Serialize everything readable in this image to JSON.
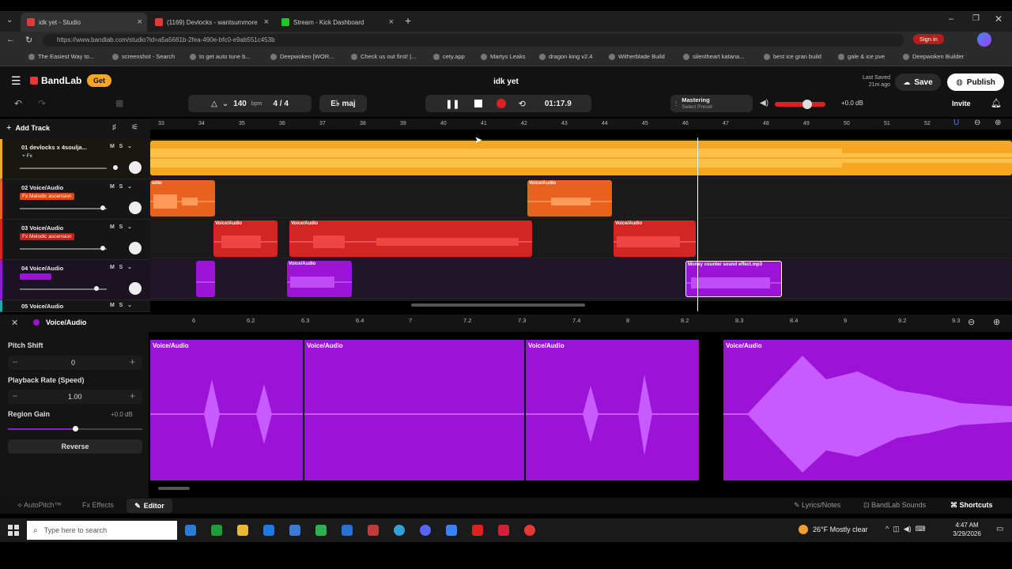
{
  "browser": {
    "tabs": [
      {
        "title": "idk yet - Studio",
        "color": "#e53935"
      },
      {
        "title": "(1169) Devlocks - wantsummore",
        "color": "#e53935"
      },
      {
        "title": "Stream - Kick Dashboard",
        "color": "#27c227"
      }
    ],
    "url": "https://www.bandlab.com/studio?id=a5a5661b-2fea-490e-bfc0-e9ab551c453b",
    "bookmarks": [
      "The Easiest Way to...",
      "screenshot - Search",
      "to get auto tune b...",
      "Deepwoken [WOR...",
      "Check us out first! |...",
      "cety.app",
      "Martys Leaks",
      "dragon king v2.4",
      "Witherblade Build",
      "silentheart katana...",
      "best ice gran build",
      "gale & ice pve",
      "Deepwoken Builder"
    ],
    "signin_label": "Sign in"
  },
  "app": {
    "brand": "BandLab",
    "get_label": "Get",
    "project_title": "idk yet",
    "last_saved_label": "Last Saved",
    "last_saved_time": "21m ago",
    "save_label": "Save",
    "publish_label": "Publish",
    "invite_label": "Invite"
  },
  "toolbar": {
    "bpm": "140",
    "bpm_unit": "bpm",
    "time_sig": "4 / 4",
    "key": "E♭ maj",
    "time": "01:17.9",
    "mastering_label": "Mastering",
    "mastering_preset": "Select Preset",
    "db": "+0.0 dB"
  },
  "timeline": {
    "add_track_label": "Add Track",
    "ruler_ticks": [
      "33",
      "34",
      "35",
      "36",
      "37",
      "38",
      "39",
      "40",
      "41",
      "42",
      "43",
      "44",
      "45",
      "46",
      "47",
      "48",
      "49",
      "50",
      "51",
      "52"
    ]
  },
  "tracks": [
    {
      "label": "01  devlocks x 4soulja...",
      "fx": "+ Fx",
      "fx_color": "#161616",
      "color": "#f5a623"
    },
    {
      "label": "02  Voice/Audio",
      "fx": "Fx  Melodic ascension",
      "fx_color": "#d9480f",
      "color": "#e8621e"
    },
    {
      "label": "03  Voice/Audio",
      "fx": "Fx  Melodic ascension",
      "fx_color": "#c91c1c",
      "color": "#d42525"
    },
    {
      "label": "04  Voice/Audio",
      "fx": "",
      "fx_color": "#9a13d6",
      "color": "#9a13d6"
    },
    {
      "label": "05  Voice/Audio",
      "fx": "",
      "fx_color": "#161616",
      "color": "#2aa"
    }
  ],
  "clip_labels": {
    "voice_audio": "Voice/Audio",
    "audio_fragment": "udio",
    "money": "Money counter sound effect.mp3"
  },
  "editor": {
    "track_name": "Voice/Audio",
    "pitch_shift_label": "Pitch Shift",
    "pitch_value": "0",
    "playback_label": "Playback Rate (Speed)",
    "playback_value": "1.00",
    "region_gain_label": "Region Gain",
    "region_gain_value": "+0.0 dB",
    "reverse_label": "Reverse",
    "ruler_ticks": [
      "6",
      "6.2",
      "6.3",
      "6.4",
      "7",
      "7.2",
      "7.3",
      "7.4",
      "8",
      "8.2",
      "8.3",
      "8.4",
      "9",
      "9.2",
      "9.3"
    ],
    "clip_label": "Voice/Audio"
  },
  "footer": {
    "autopitch": "AutoPitch™",
    "effects": "Effects",
    "editor": "Editor",
    "lyrics": "Lyrics/Notes",
    "sounds": "BandLab Sounds",
    "shortcuts": "Shortcuts"
  },
  "taskbar": {
    "search_placeholder": "Type here to search",
    "weather": "26°F  Mostly clear",
    "time": "4:47 AM",
    "date": "3/29/2026"
  },
  "colors": {
    "track1": "#f5a623",
    "track2": "#e8621e",
    "track3": "#d42525",
    "track4": "#9a13d6",
    "accent": "#f5a623",
    "record": "#e02020"
  }
}
